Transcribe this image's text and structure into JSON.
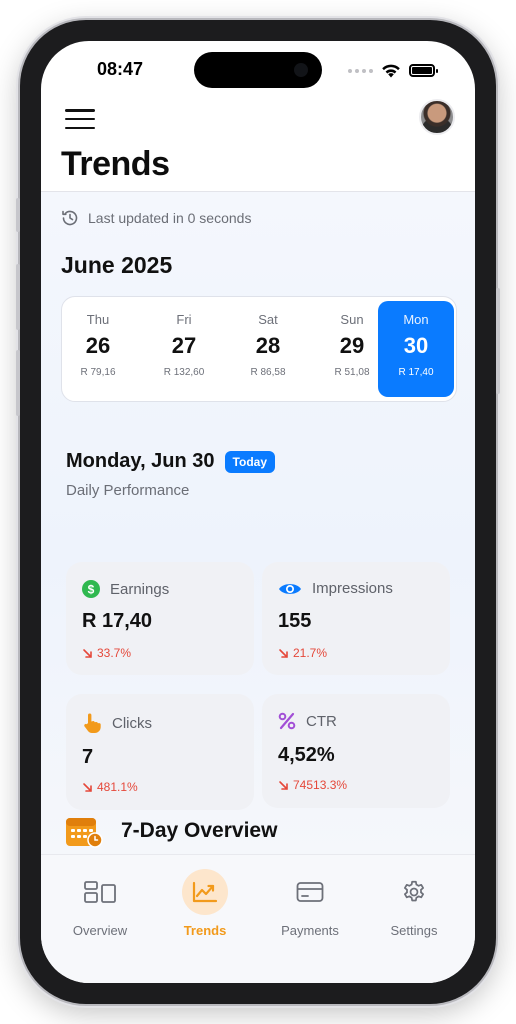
{
  "status_bar": {
    "time": "08:47"
  },
  "header": {
    "title": "Trends"
  },
  "updated": {
    "text": "Last updated in 0 seconds"
  },
  "month_label": "June 2025",
  "days": [
    {
      "dow": "Thu",
      "num": "26",
      "amount": "R 79,16"
    },
    {
      "dow": "Fri",
      "num": "27",
      "amount": "R 132,60"
    },
    {
      "dow": "Sat",
      "num": "28",
      "amount": "R 86,58"
    },
    {
      "dow": "Sun",
      "num": "29",
      "amount": "R 51,08"
    },
    {
      "dow": "Mon",
      "num": "30",
      "amount": "R 17,40",
      "selected": true
    }
  ],
  "selected_date": {
    "label": "Monday, Jun 30",
    "badge": "Today",
    "subtitle": "Daily Performance"
  },
  "metrics": {
    "earnings": {
      "label": "Earnings",
      "value": "R 17,40",
      "change": "33.7%",
      "icon": "dollar-icon"
    },
    "impressions": {
      "label": "Impressions",
      "value": "155",
      "change": "21.7%",
      "icon": "eye-icon"
    },
    "clicks": {
      "label": "Clicks",
      "value": "7",
      "change": "481.1%",
      "icon": "pointer-hand-icon"
    },
    "ctr": {
      "label": "CTR",
      "value": "4,52%",
      "change": "74513.3%",
      "icon": "percent-icon"
    }
  },
  "overview": {
    "title": "7-Day Overview",
    "icon": "calendar-icon"
  },
  "tabs": [
    {
      "label": "Overview",
      "icon": "dashboard-icon"
    },
    {
      "label": "Trends",
      "icon": "chart-icon",
      "active": true
    },
    {
      "label": "Payments",
      "icon": "card-icon"
    },
    {
      "label": "Settings",
      "icon": "gear-icon"
    }
  ],
  "colors": {
    "accent_blue": "#0a7bff",
    "accent_orange": "#f29a1b",
    "negative_red": "#e5483a"
  }
}
